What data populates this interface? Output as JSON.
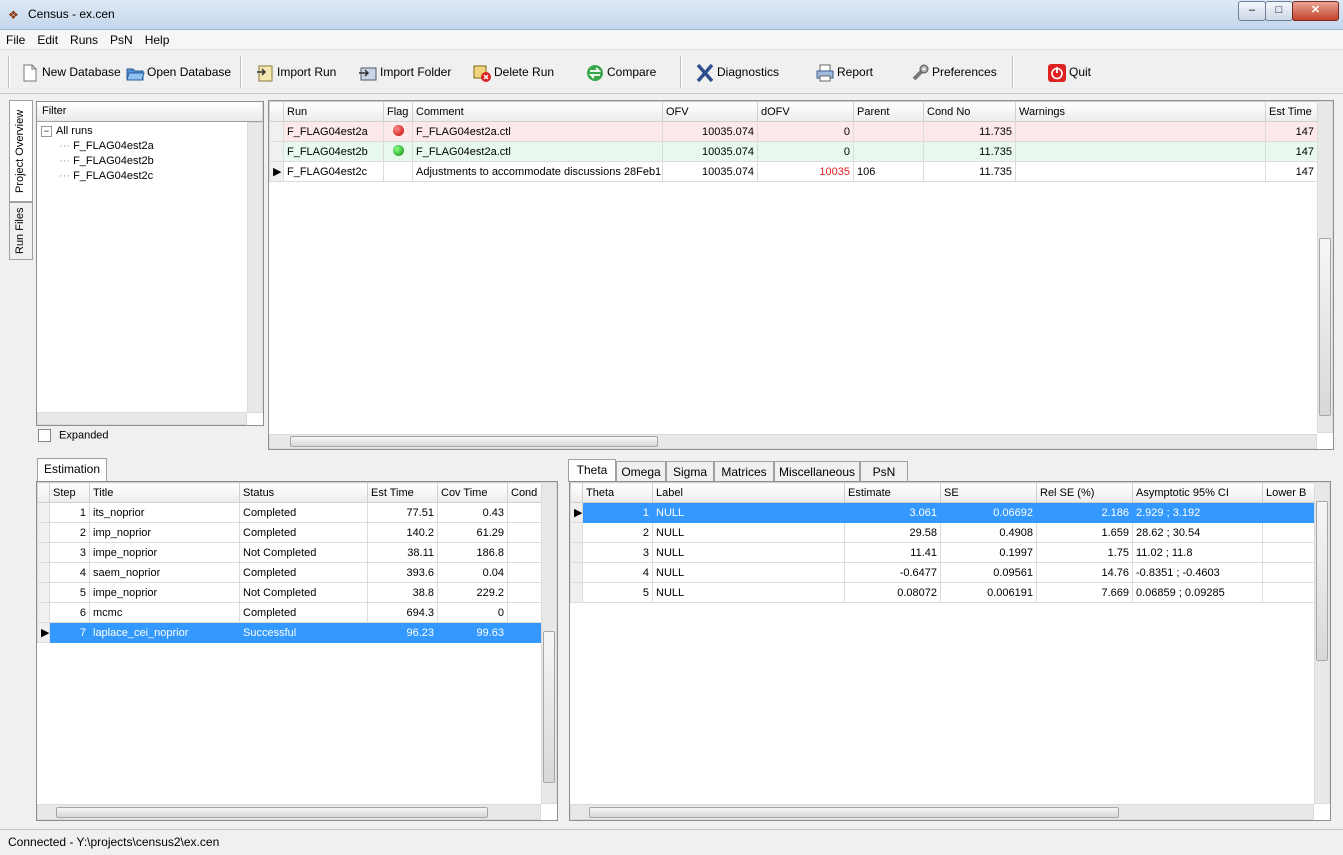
{
  "window": {
    "title": "Census - ex.cen",
    "min": "‒",
    "max": "□",
    "close": "✕"
  },
  "menu": [
    "File",
    "Edit",
    "Runs",
    "PsN",
    "Help"
  ],
  "toolbar": {
    "new_database": "New Database",
    "open_database": "Open Database",
    "import_run": "Import Run",
    "import_folder": "Import Folder",
    "delete_run": "Delete Run",
    "compare": "Compare",
    "diagnostics": "Diagnostics",
    "report": "Report",
    "preferences": "Preferences",
    "quit": "Quit"
  },
  "side_tabs": {
    "project_overview": "Project Overview",
    "run_files": "Run Files"
  },
  "filter": {
    "label": "Filter",
    "root": "All runs",
    "items": [
      "F_FLAG04est2a",
      "F_FLAG04est2b",
      "F_FLAG04est2c"
    ],
    "expanded_label": "Expanded"
  },
  "runs": {
    "columns": [
      "Run",
      "Flag",
      "Comment",
      "OFV",
      "dOFV",
      "Parent",
      "Cond No",
      "Warnings",
      "Est Time"
    ],
    "rows": [
      {
        "run": "F_FLAG04est2a",
        "flag": "red",
        "comment": "F_FLAG04est2a.ctl",
        "ofv": "10035.074",
        "dofv": "0",
        "parent": "",
        "cond": "11.735",
        "warnings": "",
        "est": "147"
      },
      {
        "run": "F_FLAG04est2b",
        "flag": "green",
        "comment": "F_FLAG04est2a.ctl",
        "ofv": "10035.074",
        "dofv": "0",
        "parent": "",
        "cond": "11.735",
        "warnings": "",
        "est": "147"
      },
      {
        "run": "F_FLAG04est2c",
        "flag": "",
        "comment": "Adjustments to accommodate discussions 28Feb1",
        "ofv": "10035.074",
        "dofv": "10035",
        "parent": "106",
        "cond": "11.735",
        "warnings": "",
        "est": "147"
      }
    ]
  },
  "estimation": {
    "tab": "Estimation",
    "columns": [
      "Step",
      "Title",
      "Status",
      "Est Time",
      "Cov Time",
      "Cond"
    ],
    "rows": [
      {
        "step": "1",
        "title": "its_noprior",
        "status": "Completed",
        "est": "77.51",
        "cov": "0.43"
      },
      {
        "step": "2",
        "title": "imp_noprior",
        "status": "Completed",
        "est": "140.2",
        "cov": "61.29"
      },
      {
        "step": "3",
        "title": "impe_noprior",
        "status": "Not Completed",
        "est": "38.11",
        "cov": "186.8"
      },
      {
        "step": "4",
        "title": "saem_noprior",
        "status": "Completed",
        "est": "393.6",
        "cov": "0.04"
      },
      {
        "step": "5",
        "title": "impe_noprior",
        "status": "Not Completed",
        "est": "38.8",
        "cov": "229.2"
      },
      {
        "step": "6",
        "title": "mcmc",
        "status": "Completed",
        "est": "694.3",
        "cov": "0"
      },
      {
        "step": "7",
        "title": "laplace_cei_noprior",
        "status": "Successful",
        "est": "96.23",
        "cov": "99.63"
      }
    ]
  },
  "params": {
    "tabs": [
      "Theta",
      "Omega",
      "Sigma",
      "Matrices",
      "Miscellaneous",
      "PsN"
    ],
    "columns": [
      "Theta",
      "Label",
      "Estimate",
      "SE",
      "Rel SE (%)",
      "Asymptotic 95% CI",
      "Lower B"
    ],
    "rows": [
      {
        "theta": "1",
        "label": "NULL",
        "est": "3.061",
        "se": "0.06692",
        "rel": "2.186",
        "ci": "2.929 ; 3.192"
      },
      {
        "theta": "2",
        "label": "NULL",
        "est": "29.58",
        "se": "0.4908",
        "rel": "1.659",
        "ci": "28.62 ; 30.54"
      },
      {
        "theta": "3",
        "label": "NULL",
        "est": "11.41",
        "se": "0.1997",
        "rel": "1.75",
        "ci": "11.02 ; 11.8"
      },
      {
        "theta": "4",
        "label": "NULL",
        "est": "-0.6477",
        "se": "0.09561",
        "rel": "14.76",
        "ci": "-0.8351 ; -0.4603"
      },
      {
        "theta": "5",
        "label": "NULL",
        "est": "0.08072",
        "se": "0.006191",
        "rel": "7.669",
        "ci": "0.06859 ; 0.09285"
      }
    ]
  },
  "status": "Connected - Y:\\projects\\census2\\ex.cen",
  "colors": {
    "selection": "#3399ff",
    "red_row": "#fde9e9",
    "green_row": "#e8f8ee"
  }
}
